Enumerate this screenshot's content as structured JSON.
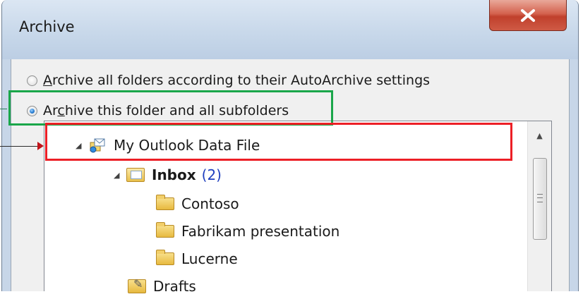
{
  "window": {
    "title": "Archive",
    "close_label": "X"
  },
  "options": {
    "archive_all": {
      "prefix": "",
      "mnemonic": "A",
      "rest": "rchive all folders according to their AutoArchive settings",
      "checked": false
    },
    "archive_folder": {
      "prefix": "Ar",
      "mnemonic": "c",
      "rest": "hive this folder and all subfolders",
      "checked": true
    }
  },
  "tree": {
    "root": {
      "label": "My Outlook Data File",
      "icon": "data-file-icon",
      "expanded": true
    },
    "inbox": {
      "label": "Inbox",
      "count": "(2)",
      "icon": "inbox-icon",
      "expanded": true
    },
    "children": [
      {
        "label": "Contoso",
        "icon": "folder-icon"
      },
      {
        "label": "Fabrikam presentation",
        "icon": "folder-icon"
      },
      {
        "label": "Lucerne",
        "icon": "folder-icon"
      }
    ],
    "drafts": {
      "label": "Drafts",
      "icon": "drafts-folder-icon"
    }
  },
  "colors": {
    "highlight_green": "#1aa64a",
    "highlight_red": "#ec1f26",
    "unread_count": "#1f3fbf"
  }
}
